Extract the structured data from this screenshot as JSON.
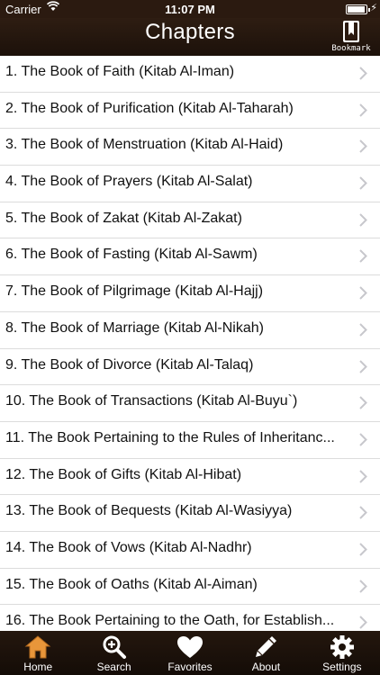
{
  "status": {
    "carrier": "Carrier",
    "time": "11:07 PM"
  },
  "header": {
    "title": "Chapters",
    "bookmark_label": "Bookmark"
  },
  "chapters": [
    "1. The Book of Faith (Kitab Al-Iman)",
    "2. The Book of Purification (Kitab Al-Taharah)",
    "3. The Book of Menstruation (Kitab Al-Haid)",
    "4. The Book of Prayers (Kitab Al-Salat)",
    "5. The Book of Zakat (Kitab Al-Zakat)",
    "6. The Book of Fasting (Kitab Al-Sawm)",
    "7. The Book of Pilgrimage (Kitab Al-Hajj)",
    "8. The Book of Marriage (Kitab Al-Nikah)",
    "9. The Book of Divorce (Kitab Al-Talaq)",
    "10. The Book of Transactions (Kitab Al-Buyu`)",
    "11. The Book Pertaining to the Rules of Inheritanc...",
    "12. The Book of Gifts (Kitab Al-Hibat)",
    "13. The Book of Bequests (Kitab Al-Wasiyya)",
    "14. The Book of Vows (Kitab Al-Nadhr)",
    "15. The Book of Oaths (Kitab Al-Aiman)",
    "16. The Book Pertaining to the Oath, for Establish..."
  ],
  "tabs": [
    {
      "label": "Home",
      "icon": "home-icon"
    },
    {
      "label": "Search",
      "icon": "search-icon"
    },
    {
      "label": "Favorites",
      "icon": "heart-icon"
    },
    {
      "label": "About",
      "icon": "pencil-icon"
    },
    {
      "label": "Settings",
      "icon": "gear-icon"
    }
  ],
  "colors": {
    "bar_brown": "#2b1a10",
    "home_active": "#e8963a",
    "icon_white": "#ffffff"
  }
}
